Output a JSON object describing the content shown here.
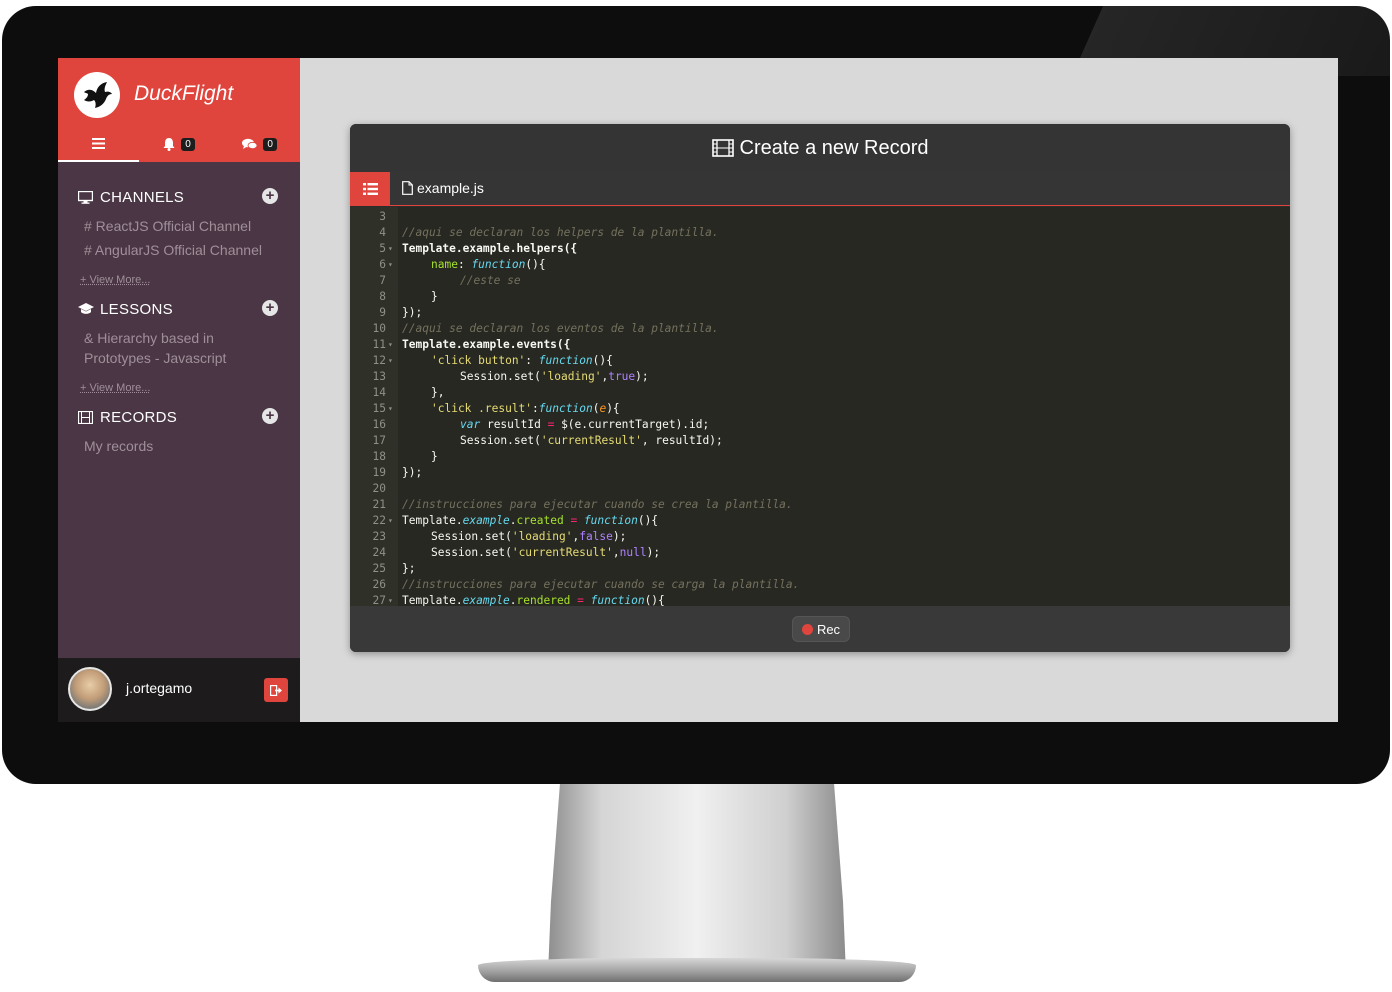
{
  "app": {
    "brand": "DuckFlight",
    "tabs": [
      {
        "icon": "menu-icon",
        "count": null
      },
      {
        "icon": "bell-icon",
        "count": "0"
      },
      {
        "icon": "comments-icon",
        "count": "0"
      }
    ]
  },
  "sidebar": {
    "channels": {
      "title": "CHANNELS",
      "items": [
        "# ReactJS Official Channel",
        "# AngularJS Official Channel"
      ],
      "view_more": "+ View More..."
    },
    "lessons": {
      "title": "LESSONS",
      "items": [
        "& Hierarchy based in",
        "Prototypes - Javascript"
      ],
      "view_more": "+ View More..."
    },
    "records": {
      "title": "RECORDS",
      "items": [
        "My records"
      ]
    },
    "user": {
      "name": "j.ortegamo"
    }
  },
  "panel": {
    "title": "Create a new Record",
    "file_name": "example.js",
    "rec_label": "Rec"
  },
  "editor": {
    "lines": [
      {
        "n": "3",
        "fold": false,
        "indent": 0,
        "tokens": []
      },
      {
        "n": "4",
        "fold": false,
        "indent": 0,
        "tokens": [
          [
            "c",
            "//aqui se declaran los helpers de la plantilla."
          ]
        ]
      },
      {
        "n": "5",
        "fold": true,
        "indent": 0,
        "tokens": [
          [
            "b",
            "Template"
          ],
          [
            "b",
            "."
          ],
          [
            "b",
            "example"
          ],
          [
            "b",
            "."
          ],
          [
            "b",
            "helpers({"
          ]
        ]
      },
      {
        "n": "6",
        "fold": true,
        "indent": 1,
        "tokens": [
          [
            "p",
            "name"
          ],
          [
            "w",
            ": "
          ],
          [
            "k",
            "function"
          ],
          [
            "w",
            "(){"
          ]
        ]
      },
      {
        "n": "7",
        "fold": false,
        "indent": 2,
        "tokens": [
          [
            "c",
            "//este se"
          ]
        ]
      },
      {
        "n": "8",
        "fold": false,
        "indent": 1,
        "tokens": [
          [
            "w",
            "}"
          ]
        ]
      },
      {
        "n": "9",
        "fold": false,
        "indent": 0,
        "tokens": [
          [
            "w",
            "});"
          ]
        ]
      },
      {
        "n": "10",
        "fold": false,
        "indent": 0,
        "tokens": [
          [
            "c",
            "//aqui se declaran los eventos de la plantilla."
          ]
        ]
      },
      {
        "n": "11",
        "fold": true,
        "indent": 0,
        "tokens": [
          [
            "b",
            "Template.example.events({"
          ]
        ]
      },
      {
        "n": "12",
        "fold": true,
        "indent": 1,
        "tokens": [
          [
            "s",
            "'click button'"
          ],
          [
            "w",
            ": "
          ],
          [
            "k",
            "function"
          ],
          [
            "w",
            "(){"
          ]
        ]
      },
      {
        "n": "13",
        "fold": false,
        "indent": 2,
        "tokens": [
          [
            "w",
            "Session.set("
          ],
          [
            "s",
            "'loading'"
          ],
          [
            "w",
            ","
          ],
          [
            "n",
            "true"
          ],
          [
            "w",
            ");"
          ]
        ]
      },
      {
        "n": "14",
        "fold": false,
        "indent": 1,
        "tokens": [
          [
            "w",
            "},"
          ]
        ]
      },
      {
        "n": "15",
        "fold": true,
        "indent": 1,
        "tokens": [
          [
            "s",
            "'click .result'"
          ],
          [
            "w",
            ":"
          ],
          [
            "k",
            "function"
          ],
          [
            "w",
            "("
          ],
          [
            "a",
            "e"
          ],
          [
            "w",
            "){"
          ]
        ]
      },
      {
        "n": "16",
        "fold": false,
        "indent": 2,
        "tokens": [
          [
            "k",
            "var"
          ],
          [
            "w",
            " resultId "
          ],
          [
            "o",
            "="
          ],
          [
            "w",
            " $(e.currentTarget).id;"
          ]
        ]
      },
      {
        "n": "17",
        "fold": false,
        "indent": 2,
        "tokens": [
          [
            "w",
            "Session.set("
          ],
          [
            "s",
            "'currentResult'"
          ],
          [
            "w",
            ", resultId);"
          ]
        ]
      },
      {
        "n": "18",
        "fold": false,
        "indent": 1,
        "tokens": [
          [
            "w",
            "}"
          ]
        ]
      },
      {
        "n": "19",
        "fold": false,
        "indent": 0,
        "tokens": [
          [
            "w",
            "});"
          ]
        ]
      },
      {
        "n": "20",
        "fold": false,
        "indent": 0,
        "tokens": []
      },
      {
        "n": "21",
        "fold": false,
        "indent": 0,
        "tokens": [
          [
            "c",
            "//instrucciones para ejecutar cuando se crea la plantilla."
          ]
        ]
      },
      {
        "n": "22",
        "fold": true,
        "indent": 0,
        "tokens": [
          [
            "w",
            "Template."
          ],
          [
            "k",
            "example"
          ],
          [
            "w",
            "."
          ],
          [
            "p",
            "created"
          ],
          [
            "w",
            " "
          ],
          [
            "o",
            "="
          ],
          [
            "w",
            " "
          ],
          [
            "k",
            "function"
          ],
          [
            "w",
            "(){"
          ]
        ]
      },
      {
        "n": "23",
        "fold": false,
        "indent": 1,
        "tokens": [
          [
            "w",
            "Session.set("
          ],
          [
            "s",
            "'loading'"
          ],
          [
            "w",
            ","
          ],
          [
            "n",
            "false"
          ],
          [
            "w",
            ");"
          ]
        ]
      },
      {
        "n": "24",
        "fold": false,
        "indent": 1,
        "tokens": [
          [
            "w",
            "Session.set("
          ],
          [
            "s",
            "'currentResult'"
          ],
          [
            "w",
            ","
          ],
          [
            "n",
            "null"
          ],
          [
            "w",
            ");"
          ]
        ]
      },
      {
        "n": "25",
        "fold": false,
        "indent": 0,
        "tokens": [
          [
            "w",
            "};"
          ]
        ]
      },
      {
        "n": "26",
        "fold": false,
        "indent": 0,
        "tokens": [
          [
            "c",
            "//instrucciones para ejecutar cuando se carga la plantilla."
          ]
        ]
      },
      {
        "n": "27",
        "fold": true,
        "indent": 0,
        "tokens": [
          [
            "w",
            "Template."
          ],
          [
            "k",
            "example"
          ],
          [
            "w",
            "."
          ],
          [
            "p",
            "rendered"
          ],
          [
            "w",
            " "
          ],
          [
            "o",
            "="
          ],
          [
            "w",
            " "
          ],
          [
            "k",
            "function"
          ],
          [
            "w",
            "(){"
          ]
        ]
      }
    ]
  },
  "colors": {
    "accent": "#e0453d",
    "sidebar": "#4a3644",
    "editor_bg": "#272822"
  }
}
